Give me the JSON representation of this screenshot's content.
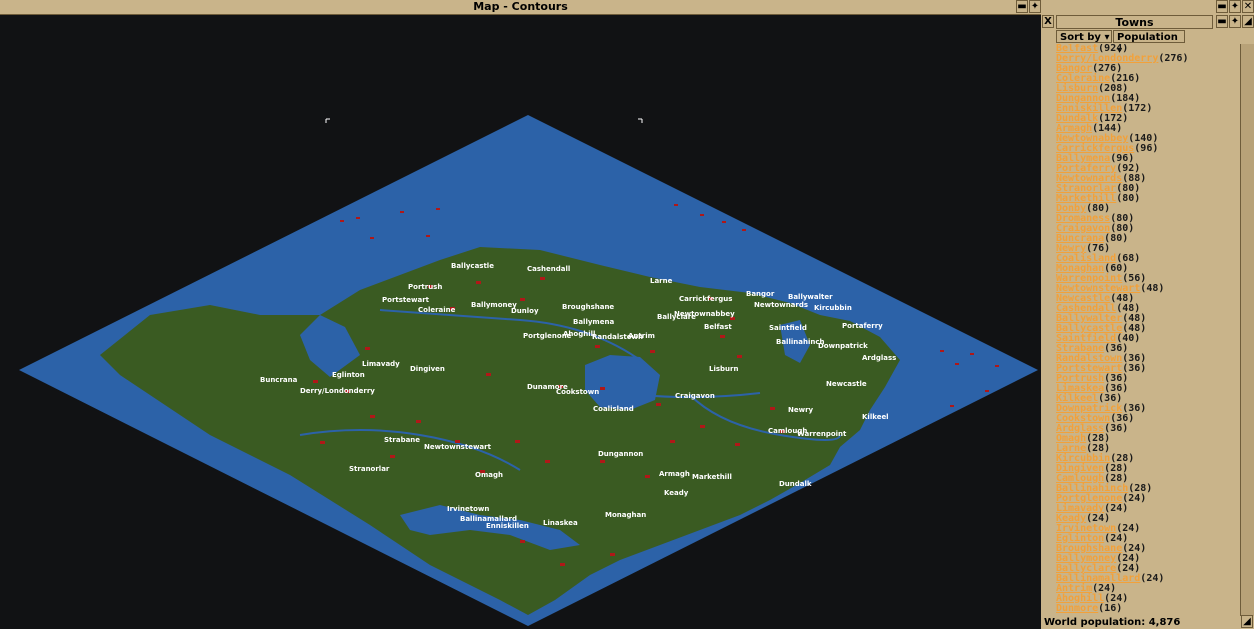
{
  "map_window": {
    "title": "Map - Contours",
    "close_label": "X"
  },
  "towns_window": {
    "title": "Towns",
    "close_label": "X",
    "sort_by_label": "Sort by",
    "sort_criteria_label": "Population",
    "world_population_label": "World population: 4,876",
    "towns": [
      {
        "name": "Belfast",
        "pop": "(924)"
      },
      {
        "name": "Derry/Londonderry",
        "pop": "(276)"
      },
      {
        "name": "Bangor",
        "pop": "(276)"
      },
      {
        "name": "Coleraine",
        "pop": "(216)"
      },
      {
        "name": "Lisburn",
        "pop": "(208)"
      },
      {
        "name": "Dungannon",
        "pop": "(184)"
      },
      {
        "name": "Enniskillen",
        "pop": "(172)"
      },
      {
        "name": "Dundalk",
        "pop": "(172)"
      },
      {
        "name": "Armagh",
        "pop": "(144)"
      },
      {
        "name": "Newtownabbey",
        "pop": "(140)"
      },
      {
        "name": "Carrickfergus",
        "pop": "(96)"
      },
      {
        "name": "Ballymena",
        "pop": "(96)"
      },
      {
        "name": "Portaferry",
        "pop": "(92)"
      },
      {
        "name": "Newtownards",
        "pop": "(88)"
      },
      {
        "name": "Stranorlar",
        "pop": "(80)"
      },
      {
        "name": "Markethill",
        "pop": "(80)"
      },
      {
        "name": "Donby",
        "pop": "(80)"
      },
      {
        "name": "Dromaness",
        "pop": "(80)"
      },
      {
        "name": "Craigavon",
        "pop": "(80)"
      },
      {
        "name": "Buncrana",
        "pop": "(80)"
      },
      {
        "name": "Newry",
        "pop": "(76)"
      },
      {
        "name": "Coalisland",
        "pop": "(68)"
      },
      {
        "name": "Monaghan",
        "pop": "(60)"
      },
      {
        "name": "Warrenpoint",
        "pop": "(56)"
      },
      {
        "name": "Newtownstewart",
        "pop": "(48)"
      },
      {
        "name": "Newcastle",
        "pop": "(48)"
      },
      {
        "name": "Cashendall",
        "pop": "(48)"
      },
      {
        "name": "Ballywalter",
        "pop": "(48)"
      },
      {
        "name": "Ballycastle",
        "pop": "(48)"
      },
      {
        "name": "Saintfield",
        "pop": "(40)"
      },
      {
        "name": "Strabane",
        "pop": "(36)"
      },
      {
        "name": "Randalstown",
        "pop": "(36)"
      },
      {
        "name": "Portstewart",
        "pop": "(36)"
      },
      {
        "name": "Portrush",
        "pop": "(36)"
      },
      {
        "name": "Limaskea",
        "pop": "(36)"
      },
      {
        "name": "Kilkeel",
        "pop": "(36)"
      },
      {
        "name": "Downpatrick",
        "pop": "(36)"
      },
      {
        "name": "Cookstown",
        "pop": "(36)"
      },
      {
        "name": "Ardglass",
        "pop": "(36)"
      },
      {
        "name": "Omagh",
        "pop": "(28)"
      },
      {
        "name": "Larne",
        "pop": "(28)"
      },
      {
        "name": "Kircubbin",
        "pop": "(28)"
      },
      {
        "name": "Dingiven",
        "pop": "(28)"
      },
      {
        "name": "Camlough",
        "pop": "(28)"
      },
      {
        "name": "Ballinahinch",
        "pop": "(28)"
      },
      {
        "name": "Portglenone",
        "pop": "(24)"
      },
      {
        "name": "Limavady",
        "pop": "(24)"
      },
      {
        "name": "Keady",
        "pop": "(24)"
      },
      {
        "name": "Irvinetown",
        "pop": "(24)"
      },
      {
        "name": "Eglinton",
        "pop": "(24)"
      },
      {
        "name": "Broughshane",
        "pop": "(24)"
      },
      {
        "name": "Ballymoney",
        "pop": "(24)"
      },
      {
        "name": "Ballyclare",
        "pop": "(24)"
      },
      {
        "name": "Ballinamallard",
        "pop": "(24)"
      },
      {
        "name": "Antrim",
        "pop": "(24)"
      },
      {
        "name": "Ahoghill",
        "pop": "(24)"
      },
      {
        "name": "Dunmore",
        "pop": "(16)"
      }
    ]
  },
  "map_labels": [
    {
      "text": "Ballycastle"
    },
    {
      "text": "Cashendall"
    },
    {
      "text": "Portrush"
    },
    {
      "text": "Larne"
    },
    {
      "text": "Portstewart"
    },
    {
      "text": "Coleraine"
    },
    {
      "text": "Ballymoney"
    },
    {
      "text": "Dunloy"
    },
    {
      "text": "Broughshane"
    },
    {
      "text": "Carrickfergus"
    },
    {
      "text": "Bangor"
    },
    {
      "text": "Ballywalter"
    },
    {
      "text": "Newtownards"
    },
    {
      "text": "Kircubbin"
    },
    {
      "text": "Ballyclare"
    },
    {
      "text": "Newtownabbey"
    },
    {
      "text": "Ballymena"
    },
    {
      "text": "Portaferry"
    },
    {
      "text": "Belfast"
    },
    {
      "text": "Saintfield"
    },
    {
      "text": "Portglenone"
    },
    {
      "text": "Ahoghill"
    },
    {
      "text": "Randalstown"
    },
    {
      "text": "Antrim"
    },
    {
      "text": "Ballinahinch"
    },
    {
      "text": "Downpatrick"
    },
    {
      "text": "Limavady"
    },
    {
      "text": "Ardglass"
    },
    {
      "text": "Eglinton"
    },
    {
      "text": "Dingiven"
    },
    {
      "text": "Lisburn"
    },
    {
      "text": "Buncrana"
    },
    {
      "text": "Derry/Londonderry"
    },
    {
      "text": "Dunamore"
    },
    {
      "text": "Cookstown"
    },
    {
      "text": "Newcastle"
    },
    {
      "text": "Craigavon"
    },
    {
      "text": "Coalisland"
    },
    {
      "text": "Newry"
    },
    {
      "text": "Kilkeel"
    },
    {
      "text": "Camlough"
    },
    {
      "text": "Warrenpoint"
    },
    {
      "text": "Strabane"
    },
    {
      "text": "Newtownstewart"
    },
    {
      "text": "Dungannon"
    },
    {
      "text": "Stranorlar"
    },
    {
      "text": "Omagh"
    },
    {
      "text": "Armagh"
    },
    {
      "text": "Markethill"
    },
    {
      "text": "Dundalk"
    },
    {
      "text": "Keady"
    },
    {
      "text": "Irvinetown"
    },
    {
      "text": "Ballinamallard"
    },
    {
      "text": "Enniskillen"
    },
    {
      "text": "Linaskea"
    },
    {
      "text": "Monaghan"
    }
  ],
  "colors": {
    "sea": "#2c62a8",
    "land": "#3a5b22",
    "town": "#b01818",
    "background": "#111214",
    "chrome": "#c9b48a",
    "town_name": "#f2a13a"
  }
}
